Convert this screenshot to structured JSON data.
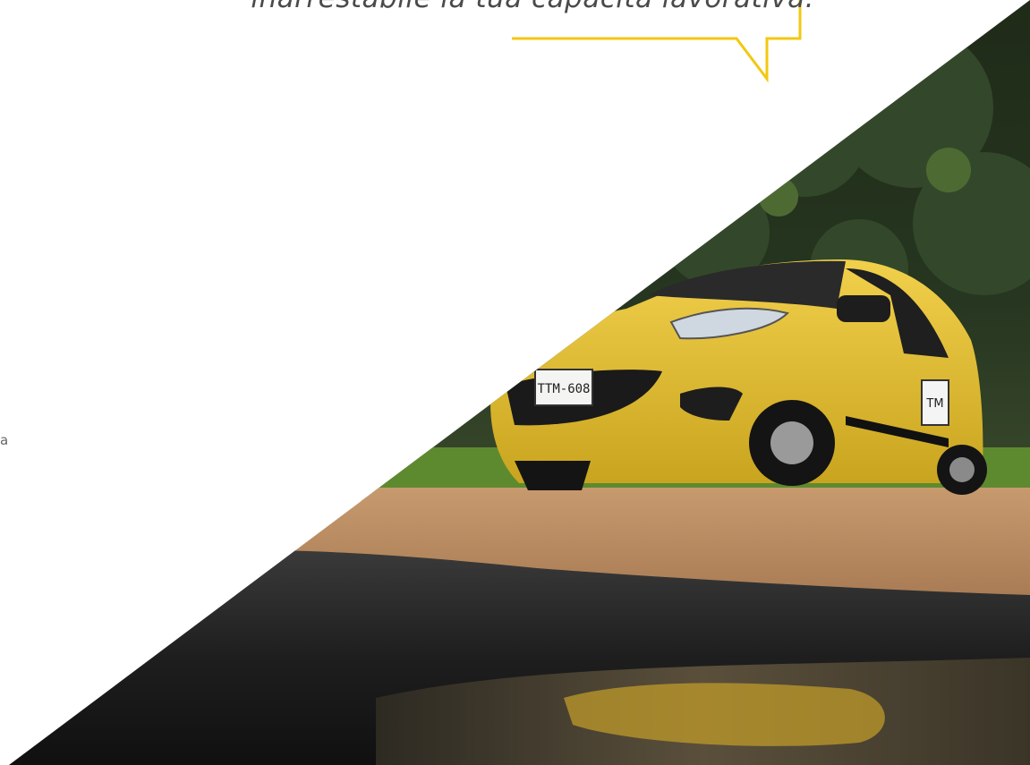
{
  "quote": {
    "text": "inarrestabile la tua capacità lavorativa."
  },
  "side_text": {
    "fragment": "a"
  },
  "photo": {
    "icon": "taxi-photo",
    "plate_text": "TTM-608",
    "door_badge": "TM"
  },
  "colors": {
    "accent": "#f2c811",
    "taxi_yellow": "#e7c22e",
    "text": "#4a4a4a"
  }
}
